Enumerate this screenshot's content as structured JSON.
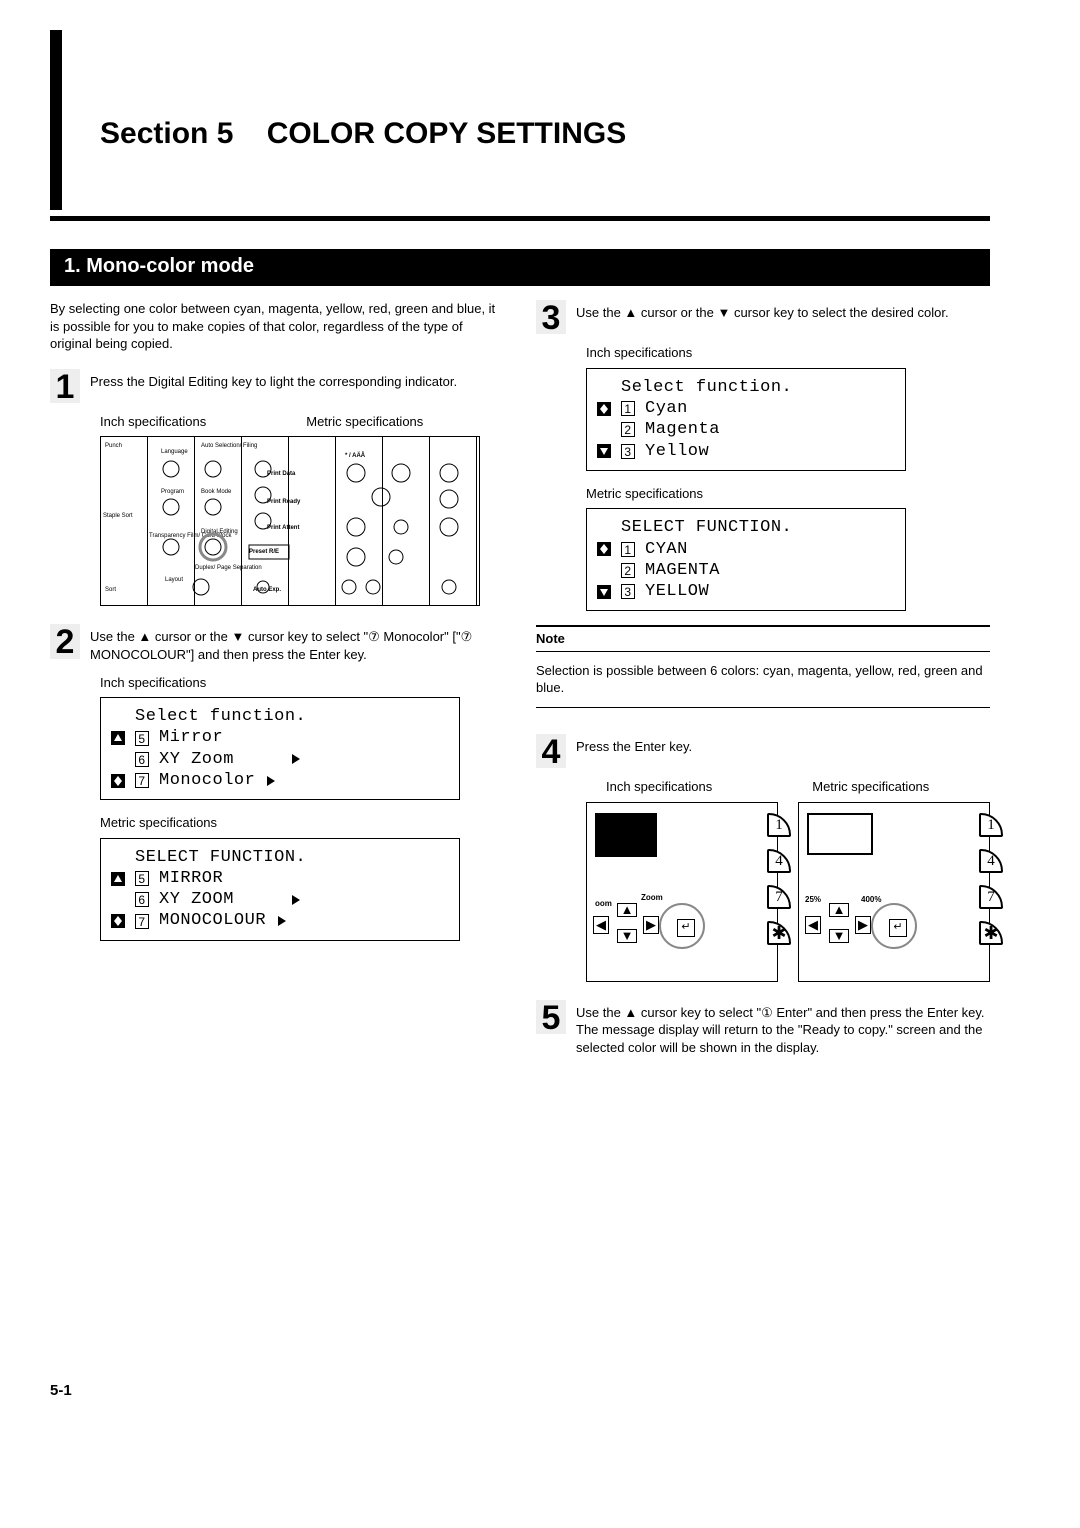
{
  "section": {
    "label": "Section 5",
    "title": "COLOR COPY SETTINGS"
  },
  "subheading": "1.  Mono-color mode",
  "intro": "By selecting one color between cyan, magenta, yellow, red, green and blue, it is possible for you to make copies of that color, regardless of the type of original being copied.",
  "steps": {
    "s1": {
      "num": "1",
      "text": "Press the Digital Editing key to light the corresponding indicator."
    },
    "s2": {
      "num": "2",
      "text": "Use the ▲ cursor or the ▼ cursor key to select \"⑦ Monocolor\" [\"⑦ MONOCOLOUR\"] and then press the Enter key."
    },
    "s3": {
      "num": "3",
      "text": "Use the ▲ cursor or the ▼ cursor key to select the desired color."
    },
    "s4": {
      "num": "4",
      "text": "Press the Enter key."
    },
    "s5": {
      "num": "5",
      "text": "Use the ▲ cursor key to select \"① Enter\" and then press the Enter key. The message display will return to the \"Ready to copy.\" screen and the selected color will be shown in the display."
    }
  },
  "labels": {
    "inch": "Inch specifications",
    "metric": "Metric specifications"
  },
  "panel": {
    "punch": "Punch",
    "language": "Language",
    "auto_sel": "Auto Selection/ Filing",
    "program": "Program",
    "book_mode": "Book Mode",
    "staple_sort": "Staple Sort",
    "trans_film": "Transparency Film/ Card Stock",
    "digital_editing": "Digital Editing",
    "layout": "Layout",
    "duplex": "Duplex/ Page Separation",
    "sort": "Sort",
    "auto_exp": "Auto Exp.",
    "print_data": "Print Data",
    "print_read": "Print Ready",
    "print_att": "Print Attent",
    "preset": "Preset R/E",
    "aaa": "* / AÄÅ"
  },
  "lcd2_inch": {
    "title": "Select function.",
    "r1_num": "5",
    "r1_txt": "Mirror",
    "r2_num": "6",
    "r2_txt": "XY Zoom",
    "r3_num": "7",
    "r3_txt": "Monocolor"
  },
  "lcd2_metric": {
    "title": "SELECT FUNCTION.",
    "r1_num": "5",
    "r1_txt": "MIRROR",
    "r2_num": "6",
    "r2_txt": "XY ZOOM",
    "r3_num": "7",
    "r3_txt": "MONOCOLOUR"
  },
  "lcd3_inch": {
    "title": "Select function.",
    "r1_num": "1",
    "r1_txt": "Cyan",
    "r2_num": "2",
    "r2_txt": "Magenta",
    "r3_num": "3",
    "r3_txt": "Yellow"
  },
  "lcd3_metric": {
    "title": "SELECT FUNCTION.",
    "r1_num": "1",
    "r1_txt": "CYAN",
    "r2_num": "2",
    "r2_txt": "MAGENTA",
    "r3_num": "3",
    "r3_txt": "YELLOW"
  },
  "note": {
    "label": "Note",
    "text": "Selection is possible between 6 colors: cyan, magenta, yellow, red, green and blue."
  },
  "keypad": {
    "k1": "1",
    "k4": "4",
    "k7": "7",
    "star": "✱",
    "zoom": "Zoom",
    "pct25": "25%",
    "pct400": "400%",
    "enter": "↵",
    "up": "▲",
    "down": "▼",
    "left": "◀",
    "right": "▶"
  },
  "page_num": "5-1"
}
